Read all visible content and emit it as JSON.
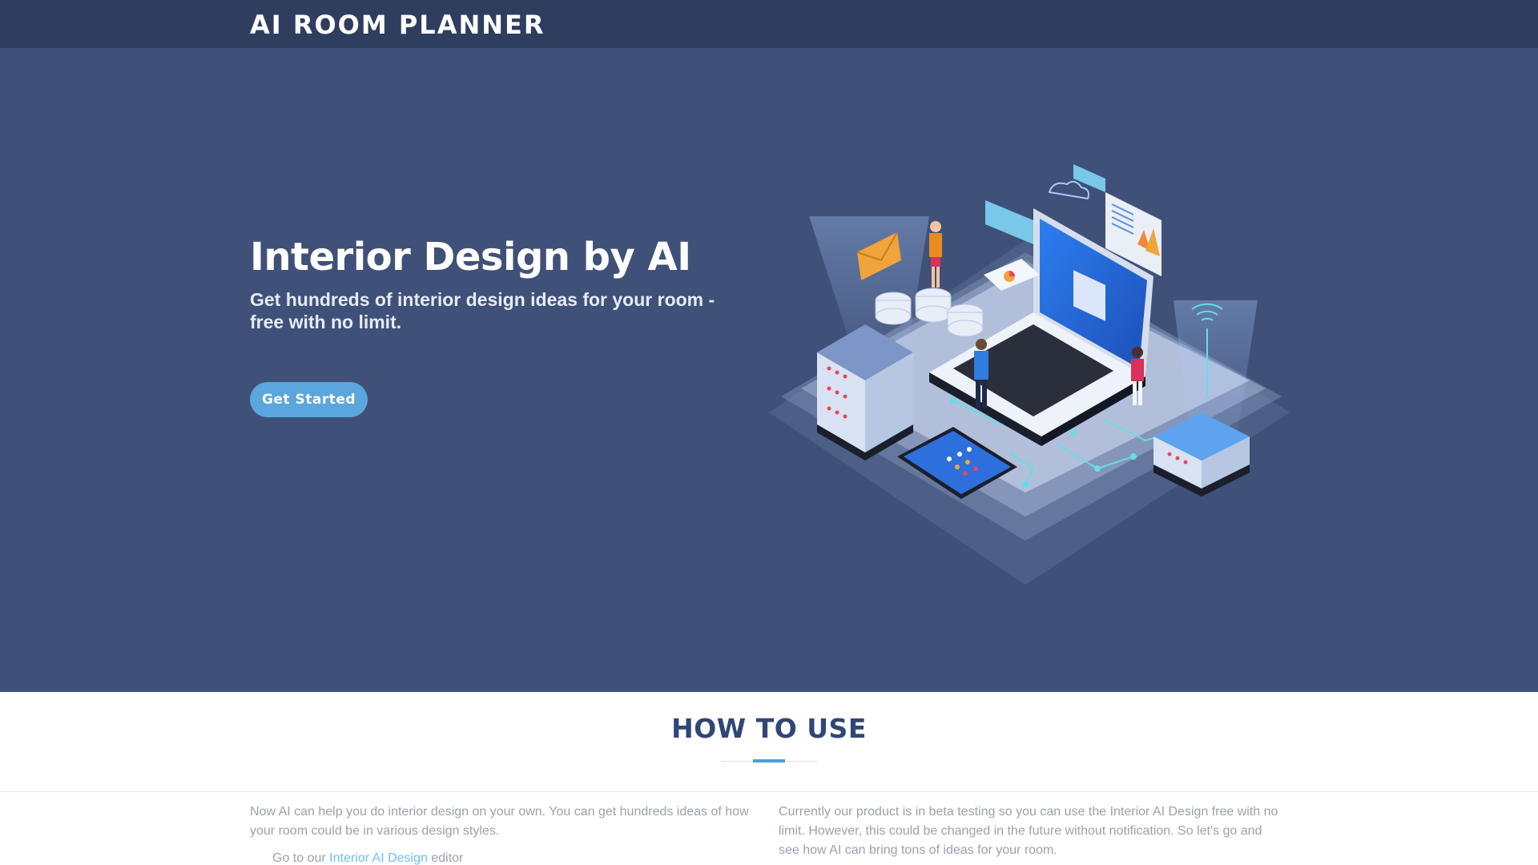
{
  "header": {
    "brand": "AI ROOM PLANNER"
  },
  "hero": {
    "title": "Interior Design by AI",
    "subtitle": "Get hundreds of interior design ideas for your room - free with no limit.",
    "cta_label": "Get Started",
    "illustration": "isometric-laptop-servers-illustration"
  },
  "how_to_use": {
    "title": "HOW TO USE",
    "left_text": "Now AI can help you do interior design on your own. You can get hundreds ideas of how your room could be in various design styles.",
    "right_text": "Currently our product is in beta testing so you can use the Interior AI Design free with no limit. However, this could be changed in the future without notification. So let's go and see how AI can bring tons of ideas for your room.",
    "step1_prefix": "Go to our",
    "step1_link": "Interior AI Design",
    "step1_suffix": "editor"
  },
  "colors": {
    "topbar": "#2f3e5f",
    "hero_bg": "#3f5178",
    "accent": "#5aa6dd",
    "heading": "#2f4775"
  }
}
